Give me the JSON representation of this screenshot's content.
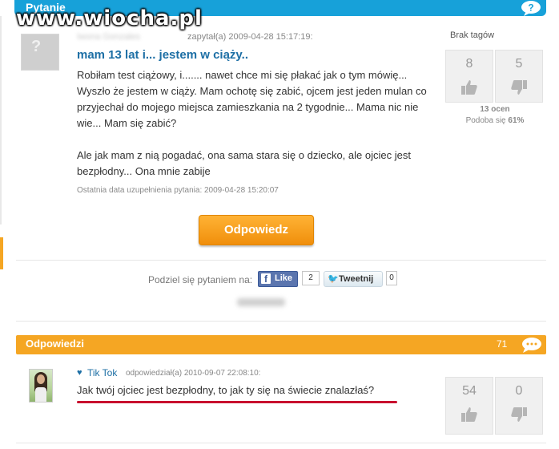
{
  "header": {
    "title": "Pytanie",
    "watermark": "www.wiocha.pl"
  },
  "question": {
    "user": "Iwona Gonzales",
    "asked": "zapytał(a) 2009-04-28 15:17:19:",
    "title": "mam 13 lat i... jestem w ciąży..",
    "body": [
      "Robiłam test ciążowy, i....... nawet chce mi się płakać jak o tym mówię... Wyszło że jestem w ciąży. Mam ochotę się zabić, ojcem jest jeden mulan co przyjechał do mojego miejsca zamieszkania na 2 tygodnie... Mama nic nie wie... Mam się zabić?",
      "Ale jak mam z nią pogadać, ona sama stara się o dziecko, ale ojciec jest bezpłodny... Ona mnie zabije"
    ],
    "updated": "Ostatnia data uzupełnienia pytania: 2009-04-28 15:20:07",
    "tags": "Brak tagów",
    "votes_up": "8",
    "votes_down": "5",
    "rating_count": "13 ocen",
    "likes_label": "Podoba się",
    "likes_percent": "61%"
  },
  "answer_button": "Odpowiedz",
  "share": {
    "label": "Podziel się pytaniem na:",
    "like_label": "Like",
    "like_count": "2",
    "tweet_label": "Tweetnij",
    "tweet_count": "0"
  },
  "answers": {
    "title": "Odpowiedzi",
    "count": "71",
    "items": [
      {
        "user": "Tik Tok",
        "meta": "odpowiedział(a) 2010-09-07 22:08:10:",
        "text": "Jak twój ojciec jest bezpłodny, to jak ty się na świecie znalazłaś?",
        "votes_up": "54",
        "votes_down": "0"
      }
    ]
  },
  "colors": {
    "header_blue": "#17a1d9",
    "accent_orange": "#f5a623",
    "link_blue": "#1d6fa5",
    "underline_red": "#c8102e"
  },
  "icons": [
    "question-bubble-icon",
    "thumbs-up-icon",
    "thumbs-down-icon",
    "facebook-icon",
    "twitter-icon",
    "comment-bubble-icon",
    "heart-icon"
  ]
}
